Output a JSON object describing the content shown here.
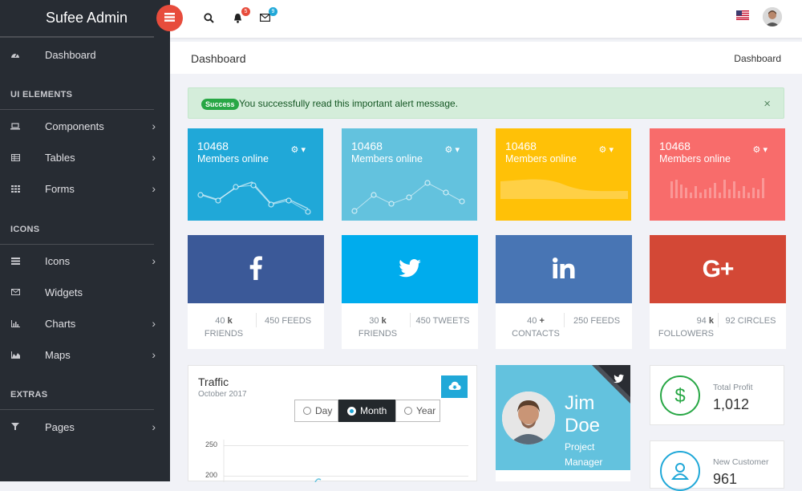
{
  "brand": {
    "light": "Sufee ",
    "bold": "Admin"
  },
  "sidebar": {
    "dashboard": "Dashboard",
    "sections": [
      "UI ELEMENTS",
      "ICONS",
      "EXTRAS"
    ],
    "items": [
      {
        "label": "Components",
        "icon": "laptop-icon"
      },
      {
        "label": "Tables",
        "icon": "table-icon"
      },
      {
        "label": "Forms",
        "icon": "grid-icon"
      },
      {
        "label": "Icons",
        "icon": "list-icon"
      },
      {
        "label": "Widgets",
        "icon": "envelope-icon"
      },
      {
        "label": "Charts",
        "icon": "bar-chart-icon"
      },
      {
        "label": "Maps",
        "icon": "area-chart-icon"
      },
      {
        "label": "Pages",
        "icon": "glass-icon"
      }
    ]
  },
  "header": {
    "notifications": "5",
    "messages": "9"
  },
  "breadcrumb": {
    "title": "Dashboard",
    "crumb": "Dashboard"
  },
  "alert": {
    "badge": "Success",
    "text": "You successfully read this important alert message.",
    "close": "×"
  },
  "stats": [
    {
      "value": "10468",
      "label": "Members online",
      "color": "#20a8d8"
    },
    {
      "value": "10468",
      "label": "Members online",
      "color": "#63c2de"
    },
    {
      "value": "10468",
      "label": "Members online",
      "color": "#ffc107"
    },
    {
      "value": "10468",
      "label": "Members online",
      "color": "#f86c6b"
    }
  ],
  "social": [
    {
      "network": "facebook",
      "color": "#3b5998",
      "left_num": "40",
      "left_unit": "k",
      "left_label": "FRIENDS",
      "right": "450 FEEDS"
    },
    {
      "network": "twitter",
      "color": "#00aced",
      "left_num": "30",
      "left_unit": "k",
      "left_label": "FRIENDS",
      "right": "450 TWEETS"
    },
    {
      "network": "linkedin",
      "color": "#4875b4",
      "left_num": "40",
      "left_unit": "+",
      "left_label": "CONTACTS",
      "right": "250 FEEDS"
    },
    {
      "network": "google-plus",
      "color": "#d34836",
      "left_num": "94",
      "left_unit": "k",
      "left_label": "FOLLOWERS",
      "right": "92 CIRCLES"
    }
  ],
  "traffic": {
    "title": "Traffic",
    "subtitle": "October 2017",
    "segments": [
      "Day",
      "Month",
      "Year"
    ],
    "selected": "Month",
    "yticks": [
      "250",
      "200"
    ]
  },
  "profile": {
    "first": "Jim",
    "last": "Doe",
    "role1": "Project",
    "role2": "Manager"
  },
  "minis": [
    {
      "label": "Total Profit",
      "value": "1,012",
      "icon": "dollar-icon",
      "color": "#28a745"
    },
    {
      "label": "New Customer",
      "value": "961",
      "icon": "user-icon",
      "color": "#20a8d8"
    }
  ]
}
